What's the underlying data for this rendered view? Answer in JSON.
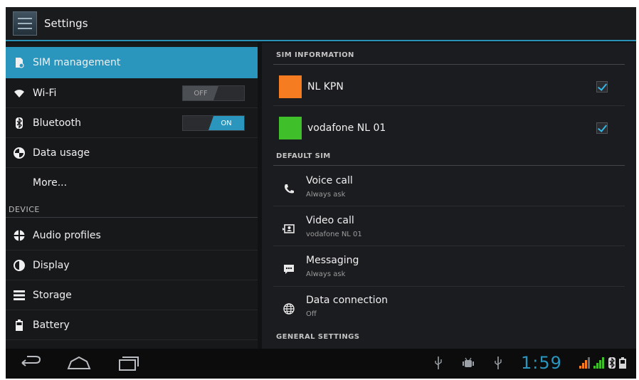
{
  "actionbar": {
    "title": "Settings",
    "icon": "settings-app-icon"
  },
  "sidebar": {
    "items": [
      {
        "label": "SIM management",
        "icon": "sim-card-icon",
        "selected": true
      },
      {
        "label": "Wi-Fi",
        "icon": "wifi-icon",
        "toggle": "OFF"
      },
      {
        "label": "Bluetooth",
        "icon": "bluetooth-icon",
        "toggle": "ON"
      },
      {
        "label": "Data usage",
        "icon": "data-usage-icon"
      },
      {
        "label": "More..."
      }
    ],
    "device_header": "DEVICE",
    "device_items": [
      {
        "label": "Audio profiles",
        "icon": "audio-profiles-icon"
      },
      {
        "label": "Display",
        "icon": "display-icon"
      },
      {
        "label": "Storage",
        "icon": "storage-icon"
      },
      {
        "label": "Battery",
        "icon": "battery-icon"
      }
    ]
  },
  "main": {
    "sim_info_header": "SIM INFORMATION",
    "sims": [
      {
        "name": "NL KPN",
        "color": "#f57c20",
        "checked": true
      },
      {
        "name": "vodafone NL 01",
        "color": "#3fbf2a",
        "checked": true
      }
    ],
    "default_sim_header": "DEFAULT SIM",
    "options": [
      {
        "title": "Voice call",
        "subtitle": "Always ask",
        "icon": "phone-icon"
      },
      {
        "title": "Video call",
        "subtitle": "vodafone NL 01",
        "icon": "video-call-icon"
      },
      {
        "title": "Messaging",
        "subtitle": "Always ask",
        "icon": "message-icon"
      },
      {
        "title": "Data connection",
        "subtitle": "Off",
        "icon": "globe-icon"
      }
    ],
    "general_header": "GENERAL SETTINGS"
  },
  "navbar": {
    "clock": "1:59",
    "accent": "#2a95bd"
  }
}
